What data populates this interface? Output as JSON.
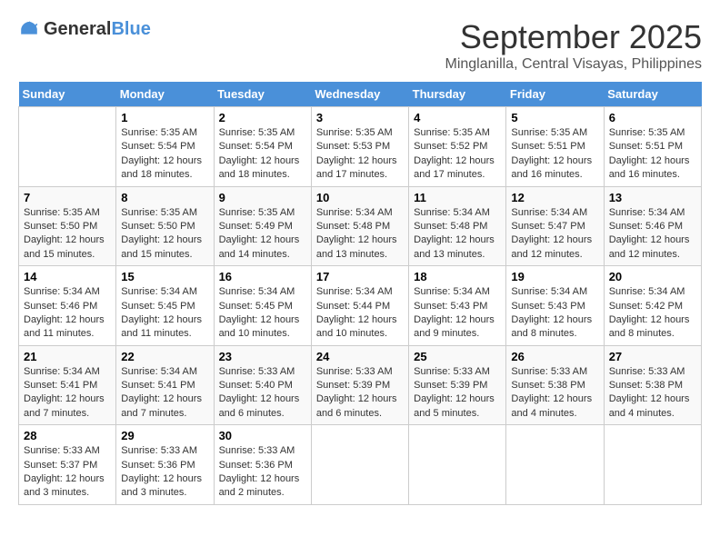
{
  "header": {
    "logo_general": "General",
    "logo_blue": "Blue",
    "month": "September 2025",
    "location": "Minglanilla, Central Visayas, Philippines"
  },
  "days_of_week": [
    "Sunday",
    "Monday",
    "Tuesday",
    "Wednesday",
    "Thursday",
    "Friday",
    "Saturday"
  ],
  "weeks": [
    [
      {
        "day": "",
        "info": ""
      },
      {
        "day": "1",
        "info": "Sunrise: 5:35 AM\nSunset: 5:54 PM\nDaylight: 12 hours\nand 18 minutes."
      },
      {
        "day": "2",
        "info": "Sunrise: 5:35 AM\nSunset: 5:54 PM\nDaylight: 12 hours\nand 18 minutes."
      },
      {
        "day": "3",
        "info": "Sunrise: 5:35 AM\nSunset: 5:53 PM\nDaylight: 12 hours\nand 17 minutes."
      },
      {
        "day": "4",
        "info": "Sunrise: 5:35 AM\nSunset: 5:52 PM\nDaylight: 12 hours\nand 17 minutes."
      },
      {
        "day": "5",
        "info": "Sunrise: 5:35 AM\nSunset: 5:51 PM\nDaylight: 12 hours\nand 16 minutes."
      },
      {
        "day": "6",
        "info": "Sunrise: 5:35 AM\nSunset: 5:51 PM\nDaylight: 12 hours\nand 16 minutes."
      }
    ],
    [
      {
        "day": "7",
        "info": "Sunrise: 5:35 AM\nSunset: 5:50 PM\nDaylight: 12 hours\nand 15 minutes."
      },
      {
        "day": "8",
        "info": "Sunrise: 5:35 AM\nSunset: 5:50 PM\nDaylight: 12 hours\nand 15 minutes."
      },
      {
        "day": "9",
        "info": "Sunrise: 5:35 AM\nSunset: 5:49 PM\nDaylight: 12 hours\nand 14 minutes."
      },
      {
        "day": "10",
        "info": "Sunrise: 5:34 AM\nSunset: 5:48 PM\nDaylight: 12 hours\nand 13 minutes."
      },
      {
        "day": "11",
        "info": "Sunrise: 5:34 AM\nSunset: 5:48 PM\nDaylight: 12 hours\nand 13 minutes."
      },
      {
        "day": "12",
        "info": "Sunrise: 5:34 AM\nSunset: 5:47 PM\nDaylight: 12 hours\nand 12 minutes."
      },
      {
        "day": "13",
        "info": "Sunrise: 5:34 AM\nSunset: 5:46 PM\nDaylight: 12 hours\nand 12 minutes."
      }
    ],
    [
      {
        "day": "14",
        "info": "Sunrise: 5:34 AM\nSunset: 5:46 PM\nDaylight: 12 hours\nand 11 minutes."
      },
      {
        "day": "15",
        "info": "Sunrise: 5:34 AM\nSunset: 5:45 PM\nDaylight: 12 hours\nand 11 minutes."
      },
      {
        "day": "16",
        "info": "Sunrise: 5:34 AM\nSunset: 5:45 PM\nDaylight: 12 hours\nand 10 minutes."
      },
      {
        "day": "17",
        "info": "Sunrise: 5:34 AM\nSunset: 5:44 PM\nDaylight: 12 hours\nand 10 minutes."
      },
      {
        "day": "18",
        "info": "Sunrise: 5:34 AM\nSunset: 5:43 PM\nDaylight: 12 hours\nand 9 minutes."
      },
      {
        "day": "19",
        "info": "Sunrise: 5:34 AM\nSunset: 5:43 PM\nDaylight: 12 hours\nand 8 minutes."
      },
      {
        "day": "20",
        "info": "Sunrise: 5:34 AM\nSunset: 5:42 PM\nDaylight: 12 hours\nand 8 minutes."
      }
    ],
    [
      {
        "day": "21",
        "info": "Sunrise: 5:34 AM\nSunset: 5:41 PM\nDaylight: 12 hours\nand 7 minutes."
      },
      {
        "day": "22",
        "info": "Sunrise: 5:34 AM\nSunset: 5:41 PM\nDaylight: 12 hours\nand 7 minutes."
      },
      {
        "day": "23",
        "info": "Sunrise: 5:33 AM\nSunset: 5:40 PM\nDaylight: 12 hours\nand 6 minutes."
      },
      {
        "day": "24",
        "info": "Sunrise: 5:33 AM\nSunset: 5:39 PM\nDaylight: 12 hours\nand 6 minutes."
      },
      {
        "day": "25",
        "info": "Sunrise: 5:33 AM\nSunset: 5:39 PM\nDaylight: 12 hours\nand 5 minutes."
      },
      {
        "day": "26",
        "info": "Sunrise: 5:33 AM\nSunset: 5:38 PM\nDaylight: 12 hours\nand 4 minutes."
      },
      {
        "day": "27",
        "info": "Sunrise: 5:33 AM\nSunset: 5:38 PM\nDaylight: 12 hours\nand 4 minutes."
      }
    ],
    [
      {
        "day": "28",
        "info": "Sunrise: 5:33 AM\nSunset: 5:37 PM\nDaylight: 12 hours\nand 3 minutes."
      },
      {
        "day": "29",
        "info": "Sunrise: 5:33 AM\nSunset: 5:36 PM\nDaylight: 12 hours\nand 3 minutes."
      },
      {
        "day": "30",
        "info": "Sunrise: 5:33 AM\nSunset: 5:36 PM\nDaylight: 12 hours\nand 2 minutes."
      },
      {
        "day": "",
        "info": ""
      },
      {
        "day": "",
        "info": ""
      },
      {
        "day": "",
        "info": ""
      },
      {
        "day": "",
        "info": ""
      }
    ]
  ]
}
